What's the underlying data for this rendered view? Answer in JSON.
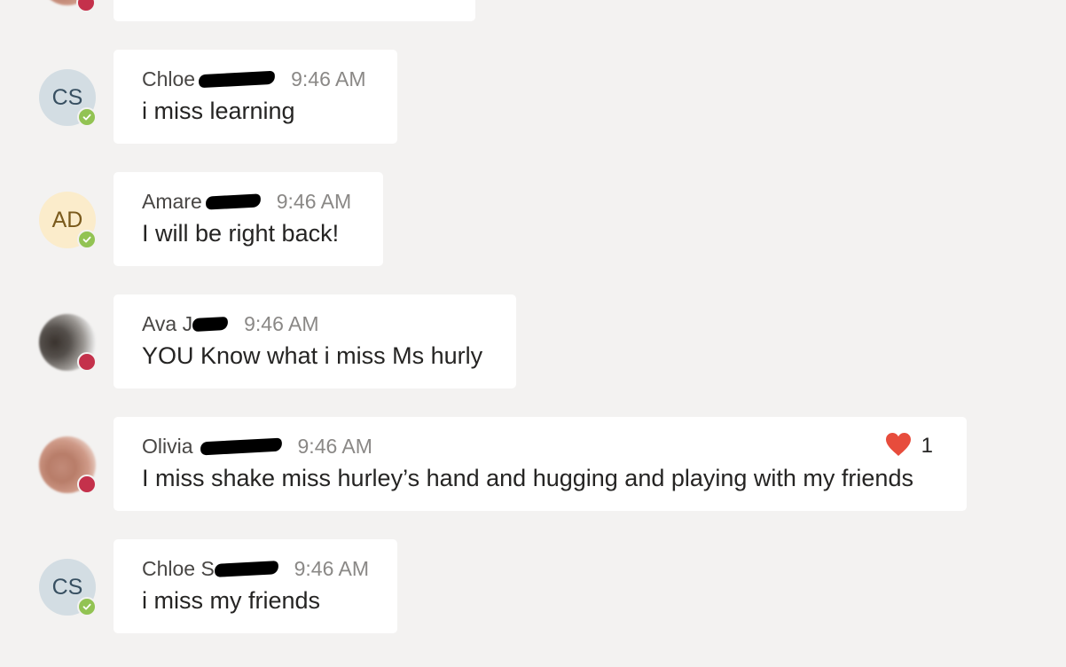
{
  "colors": {
    "available": "#92c353",
    "busy": "#c4314b",
    "heart": "#e74c3c",
    "background": "#f3f2f1",
    "bubble": "#ffffff"
  },
  "messages": [
    {
      "avatar_initials": "CS",
      "presence": "available",
      "sender": "Chloe",
      "time": "9:46 AM",
      "text": "i miss learning"
    },
    {
      "avatar_initials": "AD",
      "presence": "available",
      "sender": "Amare",
      "time": "9:46 AM",
      "text": "I will be right back!"
    },
    {
      "avatar_initials": "",
      "presence": "busy",
      "sender": "Ava J",
      "time": "9:46 AM",
      "text": "YOU Know what i miss Ms hurly"
    },
    {
      "avatar_initials": "",
      "presence": "busy",
      "sender": "Olivia",
      "time": "9:46 AM",
      "text": "I miss shake miss hurley’s hand and hugging and playing with my friends",
      "reaction": {
        "icon": "heart-icon",
        "count": "1"
      }
    },
    {
      "avatar_initials": "CS",
      "presence": "available",
      "sender": "Chloe S",
      "time": "9:46 AM",
      "text": "i miss my friends"
    }
  ]
}
